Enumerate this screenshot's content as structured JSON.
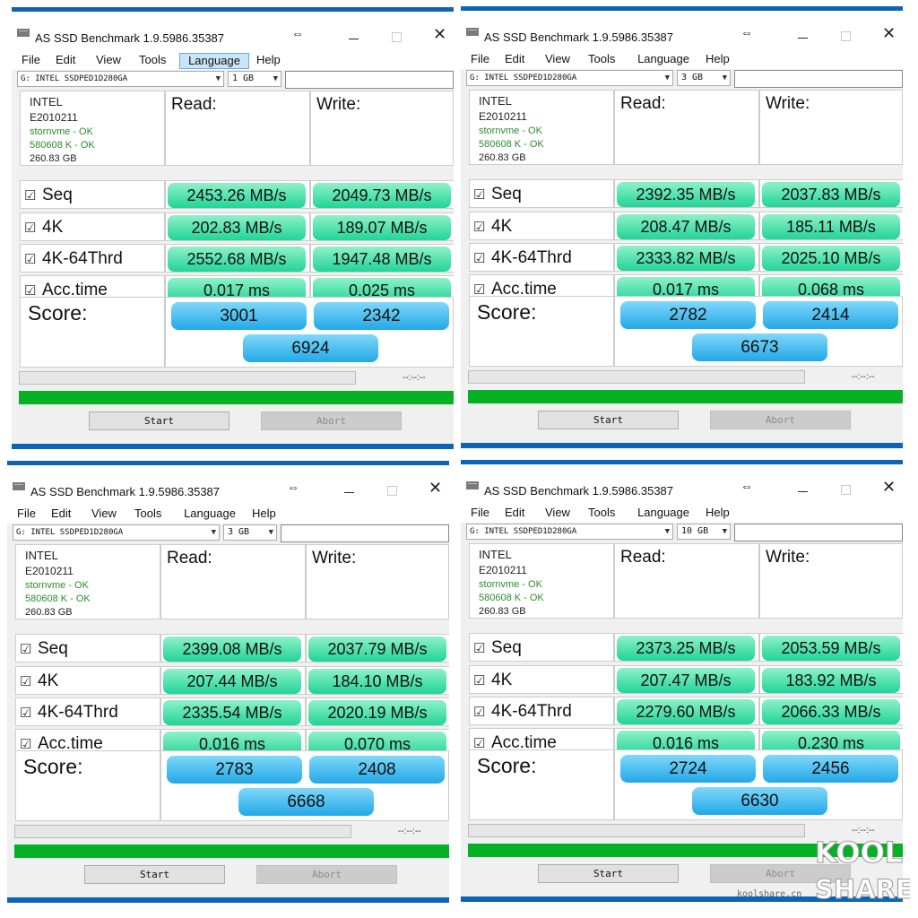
{
  "app": {
    "title": "AS SSD Benchmark 1.9.5986.35387",
    "menu": [
      "File",
      "Edit",
      "View",
      "Tools",
      "Language",
      "Help"
    ],
    "drive": "G: INTEL SSDPED1D280GA",
    "info": [
      "INTEL",
      "E2010211",
      "stornvme - OK",
      "580608 K - OK",
      "260.83 GB"
    ],
    "read_label": "Read:",
    "write_label": "Write:",
    "score_label": "Score:",
    "row_labels": [
      "Seq",
      "4K",
      "4K-64Thrd",
      "Acc.time"
    ],
    "checkbox_glyph": "☑",
    "time_placeholder": "--:--:--",
    "start_label": "Start",
    "abort_label": "Abort"
  },
  "windows": [
    {
      "size": "1 GB",
      "menu_active": "Language",
      "read": [
        "2453.26 MB/s",
        "202.83 MB/s",
        "2552.68 MB/s",
        "0.017 ms"
      ],
      "write": [
        "2049.73 MB/s",
        "189.07 MB/s",
        "1947.48 MB/s",
        "0.025 ms"
      ],
      "score_read": "3001",
      "score_write": "2342",
      "score_total": "6924"
    },
    {
      "size": "3 GB",
      "menu_active": "",
      "read": [
        "2392.35 MB/s",
        "208.47 MB/s",
        "2333.82 MB/s",
        "0.017 ms"
      ],
      "write": [
        "2037.83 MB/s",
        "185.11 MB/s",
        "2025.10 MB/s",
        "0.068 ms"
      ],
      "score_read": "2782",
      "score_write": "2414",
      "score_total": "6673"
    },
    {
      "size": "3 GB",
      "menu_active": "",
      "read": [
        "2399.08 MB/s",
        "207.44 MB/s",
        "2335.54 MB/s",
        "0.016 ms"
      ],
      "write": [
        "2037.79 MB/s",
        "184.10 MB/s",
        "2020.19 MB/s",
        "0.070 ms"
      ],
      "score_read": "2783",
      "score_write": "2408",
      "score_total": "6668"
    },
    {
      "size": "10 GB",
      "menu_active": "",
      "read": [
        "2373.25 MB/s",
        "207.47 MB/s",
        "2279.60 MB/s",
        "0.016 ms"
      ],
      "write": [
        "2053.59 MB/s",
        "183.92 MB/s",
        "2066.33 MB/s",
        "0.230 ms"
      ],
      "score_read": "2724",
      "score_write": "2456",
      "score_total": "6630"
    }
  ],
  "watermark": {
    "line1": "KOOL",
    "line2": "SHARE",
    "url": "koolshare.cn"
  },
  "colors": {
    "green_bar": "#06b025",
    "accent_blue": "#0e63b4",
    "result_green": "#21d498",
    "score_blue": "#22a8e6"
  }
}
